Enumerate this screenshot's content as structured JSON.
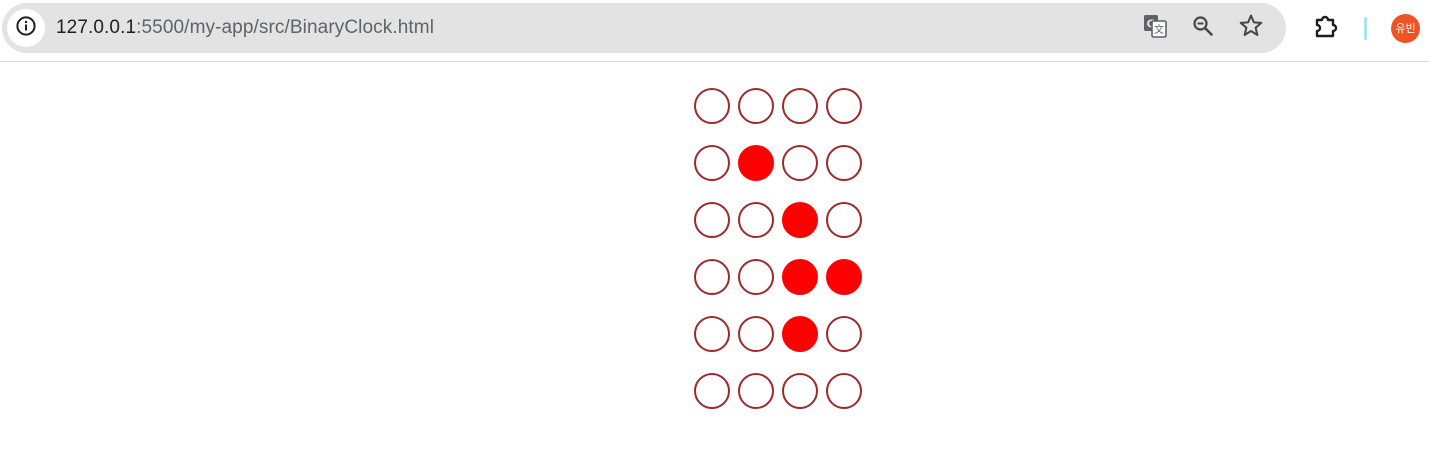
{
  "browser": {
    "url_host": "127.0.0.1",
    "url_path": ":5500/my-app/src/BinaryClock.html",
    "icons": {
      "site_info": "info-icon",
      "translate": "translate-icon",
      "zoom": "zoom-out-icon",
      "bookmark": "star-icon",
      "extensions": "puzzle-icon"
    },
    "profile": {
      "initials": "유빈",
      "color": "#f05223"
    },
    "divider_color": "#a8e4ef"
  },
  "binary_clock": {
    "on_color": "#ff0000",
    "off_border_color": "#9e2a2b",
    "rows": [
      [
        0,
        0,
        0,
        0
      ],
      [
        0,
        1,
        0,
        0
      ],
      [
        0,
        0,
        1,
        0
      ],
      [
        0,
        0,
        1,
        1
      ],
      [
        0,
        0,
        1,
        0
      ],
      [
        0,
        0,
        0,
        0
      ]
    ]
  }
}
